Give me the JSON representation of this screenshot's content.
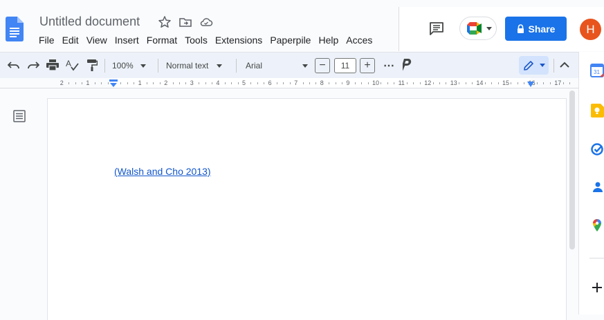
{
  "document": {
    "title": "Untitled document",
    "menu": [
      "File",
      "Edit",
      "View",
      "Insert",
      "Format",
      "Tools",
      "Extensions",
      "Paperpile",
      "Help",
      "Acces"
    ]
  },
  "header": {
    "share_label": "Share",
    "avatar_initial": "H"
  },
  "toolbar": {
    "zoom": "100%",
    "style": "Normal text",
    "font": "Arial",
    "font_size": "11",
    "decrease": "−",
    "increase": "+",
    "more": "⋯"
  },
  "ruler": {
    "labels": [
      "2",
      "1",
      "1",
      "2",
      "3",
      "4",
      "5",
      "6",
      "7",
      "8",
      "9",
      "10",
      "11",
      "12",
      "13",
      "14",
      "15",
      "16",
      "17"
    ]
  },
  "body": {
    "citation": "(Walsh and Cho 2013)"
  },
  "side_panel": {
    "calendar_day": "31"
  },
  "colors": {
    "accent": "#1a73e8",
    "link": "#1155cc",
    "avatar": "#e8541e"
  }
}
